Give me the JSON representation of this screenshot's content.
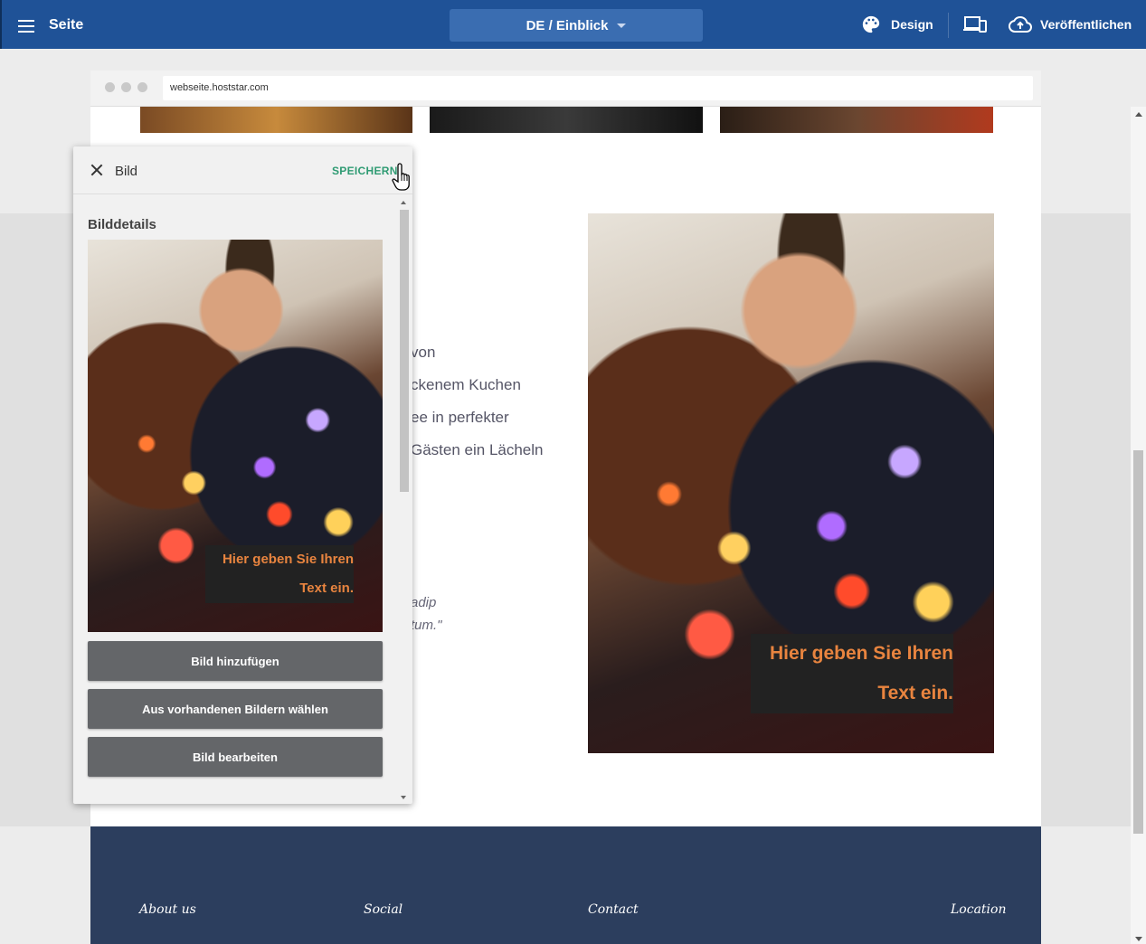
{
  "topbar": {
    "menu_label": "Seite",
    "language_selector": "DE / Einblick",
    "design_label": "Design",
    "publish_label": "Veröffentlichen"
  },
  "browser": {
    "url": "webseite.hoststar.com"
  },
  "content": {
    "text_lines": [
      "von",
      "ckenem Kuchen",
      "ee in perfekter",
      "Gästen ein Lächeln"
    ],
    "quote_lines": [
      "adip",
      "tum.\""
    ],
    "image_caption_line1": "Hier geben Sie Ihren",
    "image_caption_line2": "Text ein."
  },
  "footer": {
    "links": [
      "About us",
      "Social",
      "Contact",
      "Location"
    ]
  },
  "panel": {
    "title": "Bild",
    "save_label": "SPEICHERN",
    "section_title": "Bilddetails",
    "caption_line1": "Hier geben Sie Ihren",
    "caption_line2": "Text ein.",
    "buttons": {
      "add": "Bild hinzufügen",
      "choose": "Aus vorhandenen Bildern wählen",
      "edit": "Bild bearbeiten"
    }
  },
  "colors": {
    "topbar": "#1f5297",
    "accent_save": "#2f9b73",
    "caption_text": "#e8843f",
    "footer": "#2c3e5e",
    "panel_button": "#646669"
  },
  "icons": {
    "menu": "hamburger-icon",
    "dropdown": "chevron-down-icon",
    "design": "palette-icon",
    "devices": "devices-icon",
    "publish": "cloud-upload-icon",
    "close": "close-icon",
    "cursor": "hand-pointer-icon"
  }
}
